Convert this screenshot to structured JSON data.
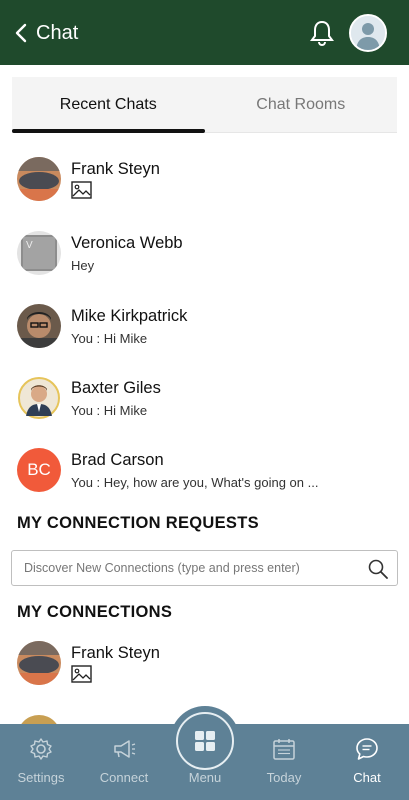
{
  "header": {
    "title": "Chat"
  },
  "tabs": [
    {
      "label": "Recent Chats",
      "active": true
    },
    {
      "label": "Chat Rooms",
      "active": false
    }
  ],
  "recent_chats": [
    {
      "name": "Frank Steyn",
      "message": "",
      "attachment": "image-icon"
    },
    {
      "name": "Veronica Webb",
      "message": "Hey"
    },
    {
      "name": "Mike Kirkpatrick",
      "message": "You : Hi Mike"
    },
    {
      "name": "Baxter Giles",
      "message": "You : Hi Mike"
    },
    {
      "name": "Brad Carson",
      "message": "You : Hey, how are you, What's going on ...",
      "initials": "BC"
    }
  ],
  "connection_requests": {
    "title": "MY CONNECTION REQUESTS",
    "search_placeholder": "Discover New Connections (type and press enter)"
  },
  "connections": {
    "title": "MY CONNECTIONS",
    "items": [
      {
        "name": "Frank Steyn",
        "attachment": "image-icon"
      }
    ]
  },
  "bottom_nav": {
    "items": [
      {
        "label": "Settings",
        "icon": "gear-icon"
      },
      {
        "label": "Connect",
        "icon": "megaphone-icon"
      },
      {
        "label": "Menu",
        "icon": "grid-icon"
      },
      {
        "label": "Today",
        "icon": "calendar-icon"
      },
      {
        "label": "Chat",
        "icon": "chat-icon",
        "active": true
      }
    ]
  },
  "colors": {
    "header_bg": "#1f4a2c",
    "nav_bg": "#5e8196",
    "initials_avatar_bg": "#f15a3a"
  }
}
